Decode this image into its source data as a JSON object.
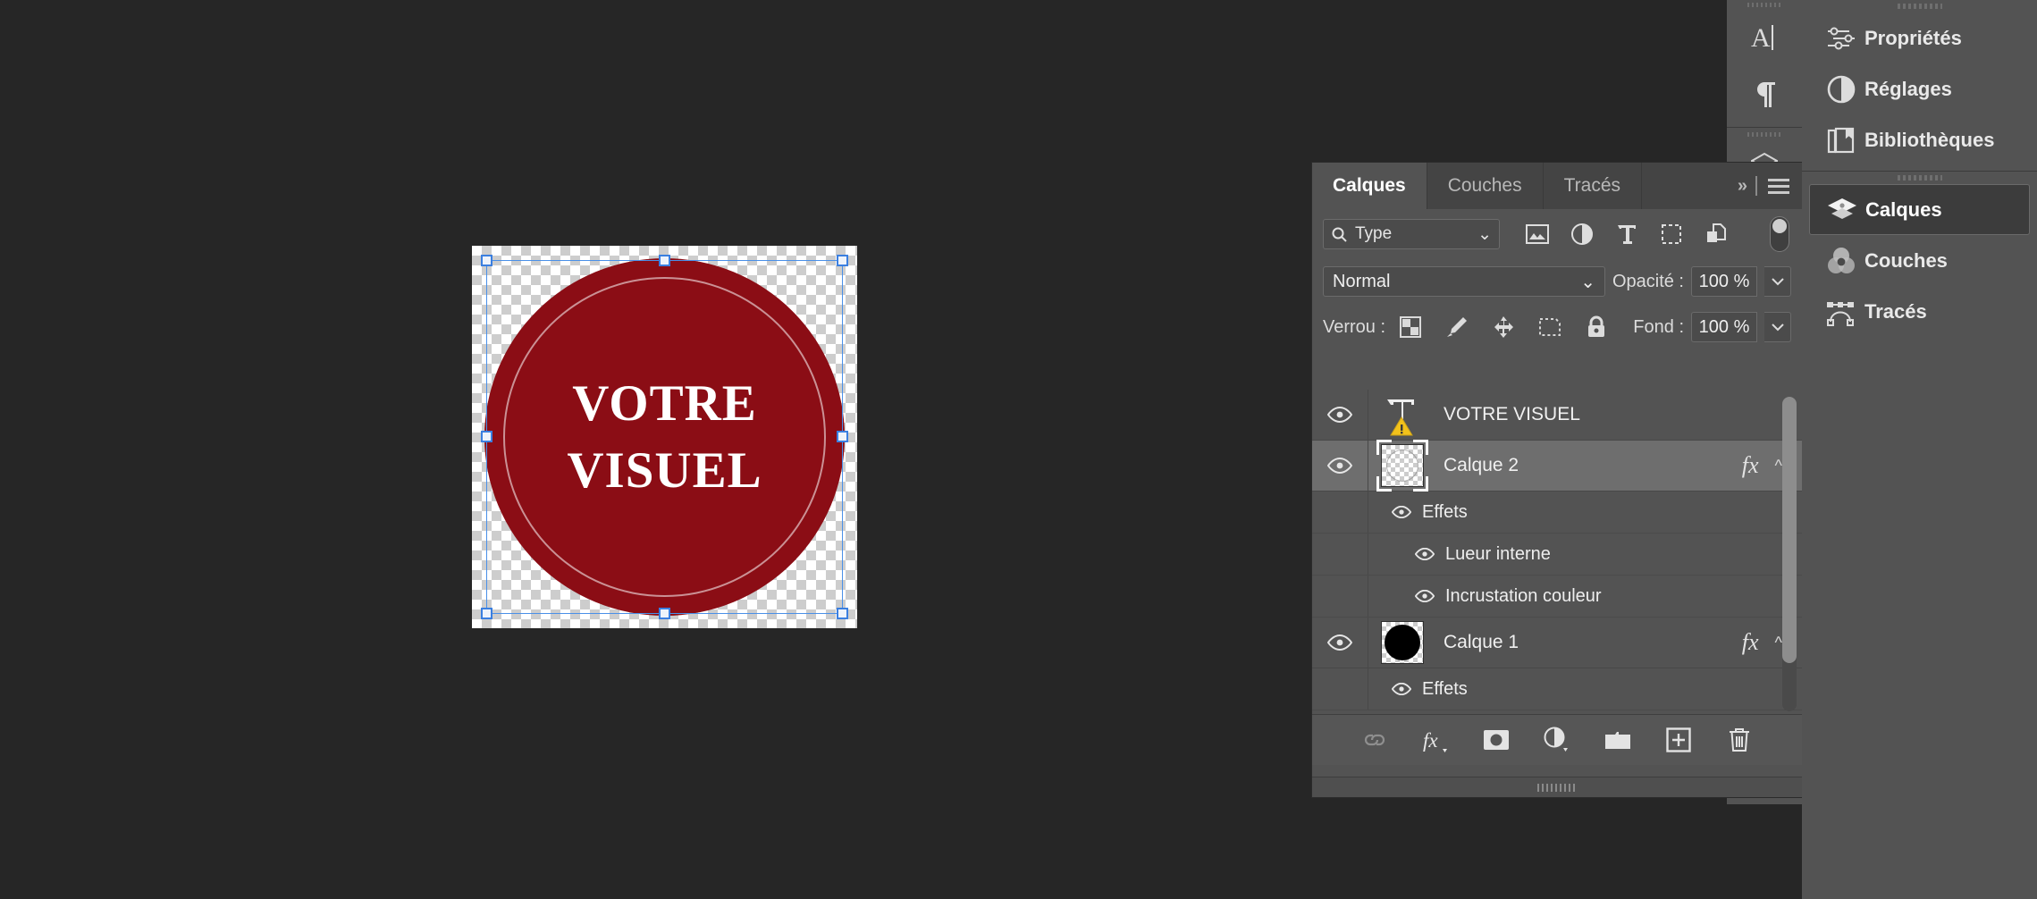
{
  "app": {
    "document_label": "VOTRE VISUEL",
    "canvas": {
      "artwork_text_line1": "VOTRE",
      "artwork_text_line2": "VISUEL",
      "disc_color": "#8b0d15",
      "ring_color": "#ffffff",
      "selection_color": "#3b7fe0"
    }
  },
  "icon_dock": {
    "items": [
      {
        "name": "character-panel",
        "icon": "character-icon"
      },
      {
        "name": "paragraph-panel",
        "icon": "paragraph-icon"
      },
      {
        "name": "3d-panel",
        "icon": "cube-icon"
      }
    ]
  },
  "layers_panel": {
    "tabs": [
      {
        "label": "Calques",
        "active": true
      },
      {
        "label": "Couches",
        "active": false
      },
      {
        "label": "Tracés",
        "active": false
      }
    ],
    "expand_label": "»",
    "menu_icon": "hamburger-menu-icon",
    "filter": {
      "search_icon": "search-icon",
      "value": "Type",
      "chevron": "⌄",
      "icons": [
        "pixel-layers-filter-icon",
        "adjustment-layers-filter-icon",
        "type-layers-filter-icon",
        "shape-layers-filter-icon",
        "smart-object-filter-icon"
      ],
      "toggle_name": "filter-enable-toggle"
    },
    "blend": {
      "mode": "Normal",
      "chevron": "⌄",
      "opacity_label": "Opacité :",
      "opacity_value": "100 %"
    },
    "lock": {
      "label": "Verrou :",
      "icons": [
        "lock-transparent-pixels-icon",
        "lock-image-pixels-icon",
        "lock-position-icon",
        "lock-artboard-nesting-icon",
        "lock-all-icon"
      ],
      "fill_label": "Fond :",
      "fill_value": "100 %"
    },
    "layers": [
      {
        "name": "VOTRE VISUEL",
        "kind": "type",
        "visible": true,
        "selected": false,
        "warning": true,
        "has_fx": false,
        "effects": []
      },
      {
        "name": "Calque 2",
        "kind": "pixel",
        "visible": true,
        "selected": true,
        "warning": false,
        "has_fx": true,
        "fx_label": "fx",
        "effects_group_label": "Effets",
        "effects": [
          "Lueur interne",
          "Incrustation couleur"
        ]
      },
      {
        "name": "Calque 1",
        "kind": "pixel",
        "visible": true,
        "selected": false,
        "warning": false,
        "has_fx": true,
        "fx_label": "fx",
        "effects_group_label": "Effets",
        "effects": []
      }
    ],
    "bottom_toolbar": [
      {
        "name": "link-layers-button",
        "icon": "link-icon"
      },
      {
        "name": "layer-style-button",
        "icon": "fx-icon"
      },
      {
        "name": "add-layer-mask-button",
        "icon": "mask-icon"
      },
      {
        "name": "new-adjustment-layer-button",
        "icon": "adjustment-icon"
      },
      {
        "name": "new-group-button",
        "icon": "folder-icon"
      },
      {
        "name": "new-layer-button",
        "icon": "plus-square-icon"
      },
      {
        "name": "delete-layer-button",
        "icon": "trash-icon"
      }
    ]
  },
  "rail": {
    "group_top": [
      {
        "label": "Propriétés",
        "icon": "sliders-icon",
        "active": false
      },
      {
        "label": "Réglages",
        "icon": "half-circle-icon",
        "active": false
      },
      {
        "label": "Bibliothèques",
        "icon": "library-book-icon",
        "active": false
      }
    ],
    "group_bottom": [
      {
        "label": "Calques",
        "icon": "layers-stack-icon",
        "active": true
      },
      {
        "label": "Couches",
        "icon": "channels-venn-icon",
        "active": false
      },
      {
        "label": "Tracés",
        "icon": "paths-pen-icon",
        "active": false
      }
    ]
  }
}
